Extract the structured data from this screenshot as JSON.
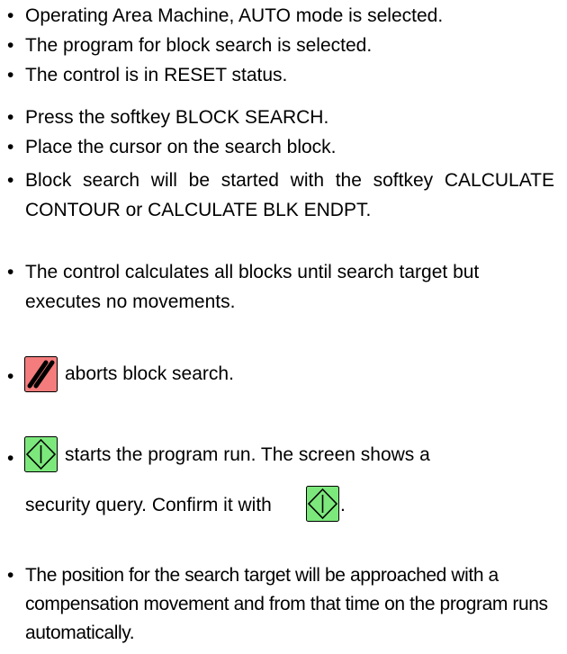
{
  "bullet_char": "•",
  "colors": {
    "reset_key": "#f47c7c",
    "start_key": "#7ce87c"
  },
  "prerequisites": [
    "Operating Area Machine, AUTO mode is selected.",
    "The program for block search is selected.",
    "The control is in RESET status."
  ],
  "steps": [
    "Press the softkey BLOCK SEARCH.",
    "Place the cursor on the search block.",
    "Block search will be started with the softkey CALCULATE CONTOUR or CALCULATE BLK ENDPT.",
    "The control calculates all blocks until search target but executes no movements."
  ],
  "reset_key": {
    "icon": "reset-slash-icon",
    "text": "aborts block search."
  },
  "start_key": {
    "icon": "cycle-start-icon",
    "text_line1": "starts the program run. The screen shows a",
    "text_line2": "security query. Confirm it with",
    "text_end": "."
  },
  "final_step": "The position for the search target will be approached with a compensation movement and from that time on the program runs automatically."
}
